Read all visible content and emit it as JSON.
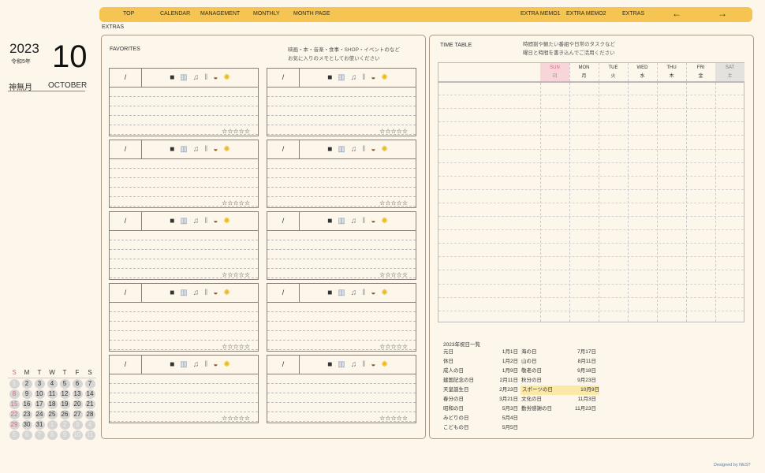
{
  "nav": {
    "items": [
      "TOP",
      "CALENDAR",
      "MANAGEMENT",
      "MONTHLY",
      "MONTH PAGE",
      "EXTRA MEMO1",
      "EXTRA MEMO2",
      "EXTRAS"
    ],
    "prev": "←",
    "next": "→",
    "bg": "#f5c453"
  },
  "breadcrumb": "EXTRAS",
  "date": {
    "year": "2023",
    "reiwa": "令和5年",
    "month": "10",
    "jp_month": "神無月",
    "en_month": "OCTOBER"
  },
  "favorites": {
    "title": "FAVORITES",
    "note1": "映画・本・音楽・食事・SHOP・イベントのなど",
    "note2": "お気に入りのメモとしてお使いください",
    "date_placeholder": "/",
    "stars": "☆☆☆☆☆",
    "icons": [
      {
        "name": "movie-camera-icon",
        "glyph": "■",
        "color": "#333"
      },
      {
        "name": "book-icon",
        "glyph": "▥",
        "color": "#8aa0c0"
      },
      {
        "name": "music-icon",
        "glyph": "♫",
        "color": "#777"
      },
      {
        "name": "fork-knife-icon",
        "glyph": "‖",
        "color": "#999"
      },
      {
        "name": "handbag-icon",
        "glyph": "◒",
        "color": "#8b5a2b"
      },
      {
        "name": "clap-icon",
        "glyph": "✺",
        "color": "#e8b820"
      }
    ]
  },
  "timetable": {
    "title": "TIME TABLE",
    "note1": "時間割や観たい番組や日常のタスクなど",
    "note2": "曜日と時間を書き込んでご活用ください",
    "days": [
      {
        "en": "SUN",
        "jp": "日",
        "bg": "#f7d5d8",
        "color": "#d07080"
      },
      {
        "en": "MON",
        "jp": "月"
      },
      {
        "en": "TUE",
        "jp": "火"
      },
      {
        "en": "WED",
        "jp": "水"
      },
      {
        "en": "THU",
        "jp": "木"
      },
      {
        "en": "FRI",
        "jp": "金"
      },
      {
        "en": "SAT",
        "jp": "土",
        "bg": "#e4e2df",
        "color": "#777"
      }
    ]
  },
  "holidays": {
    "title": "2023年祝日一覧",
    "highlight": "#fbe9a8",
    "items": [
      [
        "元日",
        "1月1日"
      ],
      [
        "休日",
        "1月2日"
      ],
      [
        "成人の日",
        "1月9日"
      ],
      [
        "建国記念の日",
        "2月11日"
      ],
      [
        "天皇誕生日",
        "2月23日"
      ],
      [
        "春分の日",
        "3月21日"
      ],
      [
        "昭和の日",
        "5月3日"
      ],
      [
        "みどりの日",
        "5月4日"
      ],
      [
        "こどもの日",
        "5月5日"
      ],
      [
        "海の日",
        "7月17日"
      ],
      [
        "山の日",
        "8月11日"
      ],
      [
        "敬老の日",
        "9月18日"
      ],
      [
        "秋分の日",
        "9月23日"
      ],
      [
        "スポーツの日",
        "10月9日"
      ],
      [
        "文化の日",
        "11月3日"
      ],
      [
        "勤労感謝の日",
        "11月23日"
      ]
    ]
  },
  "mini_calendar": {
    "weekdays": [
      "S",
      "M",
      "T",
      "W",
      "T",
      "F",
      "S"
    ],
    "sunday_color": "#d07080",
    "weeks": [
      [
        "1",
        "2",
        "3",
        "4",
        "5",
        "6",
        "7"
      ],
      [
        "8",
        "9",
        "10",
        "11",
        "12",
        "13",
        "14"
      ],
      [
        "15",
        "16",
        "17",
        "18",
        "19",
        "20",
        "21"
      ],
      [
        "22",
        "23",
        "24",
        "25",
        "26",
        "27",
        "28"
      ],
      [
        "29",
        "30",
        "31",
        "1",
        "2",
        "3",
        "4"
      ],
      [
        "5",
        "6",
        "7",
        "8",
        "9",
        "10",
        "11"
      ]
    ]
  },
  "credit": "Designed by NEST"
}
